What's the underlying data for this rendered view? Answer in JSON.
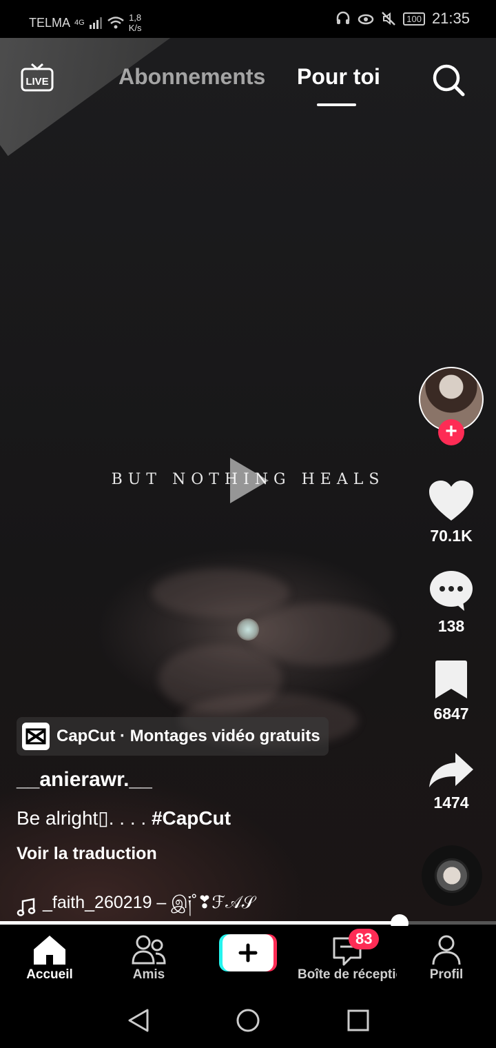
{
  "status_bar": {
    "carrier": "TELMA",
    "network": "4G",
    "speed_value": "1,8",
    "speed_unit": "K/s",
    "battery": "100",
    "time": "21:35"
  },
  "top_nav": {
    "live_label": "LIVE",
    "tab_following": "Abonnements",
    "tab_for_you": "Pour toi"
  },
  "video": {
    "overlay_text": "BUT NOTHING HEALS",
    "progress": 0.805
  },
  "actions": {
    "likes": "70.1K",
    "comments": "138",
    "saves": "6847",
    "shares": "1474"
  },
  "post": {
    "capcut_label": "CapCut · Montages vidéo gratuits",
    "username": "__anierawr.__",
    "caption_text": "Be alright▯. . . . ",
    "caption_tag": "#CapCut",
    "see_translation": "Voir la traduction",
    "music": "_faith_260219 – இ༏˚❣ℱ𝒜𝒮"
  },
  "bottom_nav": {
    "home": "Accueil",
    "friends": "Amis",
    "inbox": "Boîte de réceptio",
    "inbox_badge": "83",
    "profile": "Profil"
  },
  "colors": {
    "accent": "#fe2c55",
    "background": "#000000"
  }
}
